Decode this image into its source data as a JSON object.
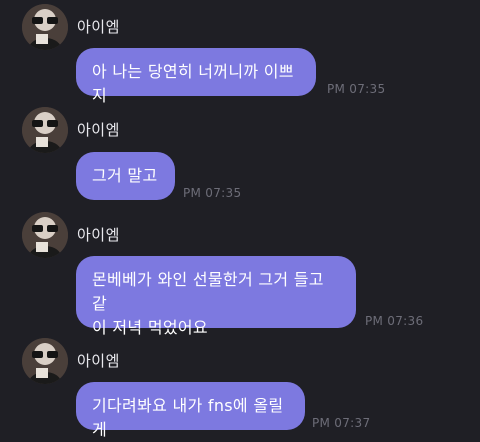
{
  "messages": [
    {
      "sender": "아이엠",
      "text": "아 나는 당연히 너꺼니까 이쁘지",
      "time": "PM 07:35"
    },
    {
      "sender": "아이엠",
      "text": "그거 말고",
      "time": "PM 07:35"
    },
    {
      "sender": "아이엠",
      "text": "몬베베가 와인 선물한거 그거 들고 같\n이 저녁 먹었어요",
      "time": "PM 07:36"
    },
    {
      "sender": "아이엠",
      "text": "기다려봐요 내가 fns에 올릴게",
      "time": "PM 07:37"
    }
  ],
  "colors": {
    "background": "#1f1f25",
    "bubble": "#7d79e0",
    "timestamp": "#6d6d78"
  },
  "avatar_icon": "profile-photo-icon"
}
